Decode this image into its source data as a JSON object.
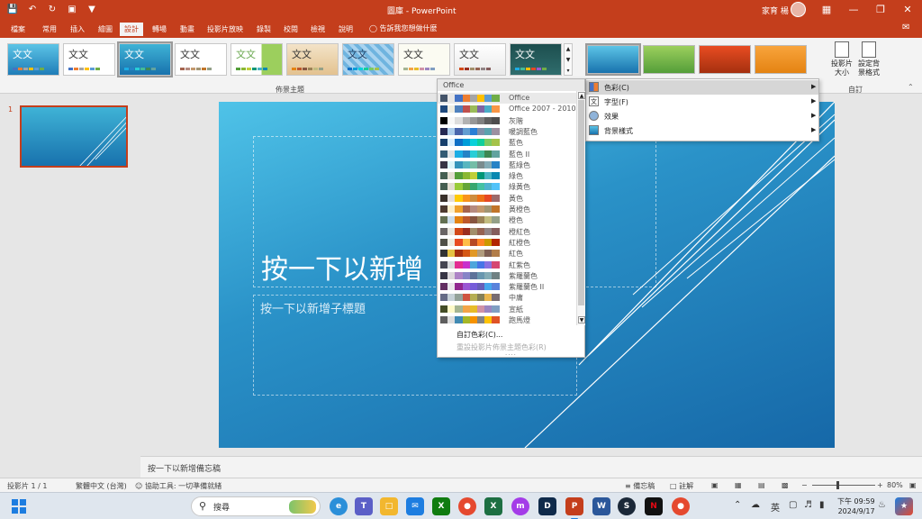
{
  "window": {
    "title": "圖庫 - PowerPoint",
    "user_name": "家育 楊"
  },
  "tabs": [
    {
      "label": "檔案",
      "active": false
    },
    {
      "label": "常用",
      "active": false
    },
    {
      "label": "插入",
      "active": false
    },
    {
      "label": "繪圖",
      "active": false
    },
    {
      "label": "設計",
      "active": true
    },
    {
      "label": "轉場",
      "active": false
    },
    {
      "label": "動畫",
      "active": false
    },
    {
      "label": "投影片放映",
      "active": false
    },
    {
      "label": "錄製",
      "active": false
    },
    {
      "label": "校閱",
      "active": false
    },
    {
      "label": "檢視",
      "active": false
    },
    {
      "label": "說明",
      "active": false
    }
  ],
  "tell_me": "告訴我您想做什麼",
  "ribbon": {
    "themes_group_label": "佈景主題",
    "theme_thumb_text": "文文",
    "customize_group_label": "自訂",
    "slide_size_label": "投影片大小",
    "format_bg_label": "設定背景格式"
  },
  "slide": {
    "number": "1",
    "title_placeholder": "按一下以新增",
    "subtitle_placeholder": "按一下以新增子標題"
  },
  "notes_placeholder": "按一下以新增備忘稿",
  "status": {
    "slide_count": "投影片 1 / 1",
    "language": "繁體中文 (台灣)",
    "accessibility": "協助工具: 一切準備就緒",
    "notes_btn": "備忘稿",
    "comments_btn": "註解",
    "zoom": "80%"
  },
  "taskbar": {
    "search_text": "搜尋",
    "ime": "英",
    "time": "下午 09:59",
    "date": "2024/9/17"
  },
  "color_menu": {
    "header": "Office",
    "schemes": [
      {
        "name": "Office",
        "colors": [
          "#44546a",
          "#e7e6e6",
          "#4472c4",
          "#ed7d31",
          "#a5a5a5",
          "#ffc000",
          "#5b9bd5",
          "#70ad47"
        ]
      },
      {
        "name": "Office 2007 - 2010",
        "colors": [
          "#1f497d",
          "#eeece1",
          "#4f81bd",
          "#c0504d",
          "#9bbb59",
          "#8064a2",
          "#4bacc6",
          "#f79646"
        ]
      },
      {
        "name": "灰階",
        "colors": [
          "#000000",
          "#f8f8f8",
          "#dddddd",
          "#b2b2b2",
          "#969696",
          "#808080",
          "#5f5f5f",
          "#4d4d4d"
        ]
      },
      {
        "name": "暖調藍色",
        "colors": [
          "#242852",
          "#acccea",
          "#4a66ac",
          "#629dd1",
          "#297fd5",
          "#7f8fa9",
          "#5aa2ae",
          "#9d90a0"
        ]
      },
      {
        "name": "藍色",
        "colors": [
          "#17406d",
          "#dbefff",
          "#0f6fc6",
          "#009dd9",
          "#0bd0d9",
          "#10cf9b",
          "#7cca62",
          "#a5c249"
        ]
      },
      {
        "name": "藍色 II",
        "colors": [
          "#335b74",
          "#dfe3e5",
          "#1cade4",
          "#2683c6",
          "#27ced7",
          "#42ba97",
          "#3e8853",
          "#62a39f"
        ]
      },
      {
        "name": "藍綠色",
        "colors": [
          "#373545",
          "#dbf5f9",
          "#3494ba",
          "#58b6c0",
          "#75bda7",
          "#7a8c8e",
          "#84acb6",
          "#2683c6"
        ]
      },
      {
        "name": "綠色",
        "colors": [
          "#455f51",
          "#e3ded1",
          "#549e39",
          "#8ab833",
          "#c0cf3a",
          "#029676",
          "#4ab5c4",
          "#0989b1"
        ]
      },
      {
        "name": "綠黃色",
        "colors": [
          "#455f51",
          "#e3ded1",
          "#99cb38",
          "#63a537",
          "#37a76f",
          "#44c1a3",
          "#4eb3cf",
          "#51c3f9"
        ]
      },
      {
        "name": "黃色",
        "colors": [
          "#39302a",
          "#e5dedb",
          "#ffca08",
          "#f8931d",
          "#ce8d3e",
          "#ec7016",
          "#e64823",
          "#9c6a6a"
        ]
      },
      {
        "name": "黃橙色",
        "colors": [
          "#4e3b30",
          "#fbeec9",
          "#f0a22e",
          "#a5644e",
          "#b58b80",
          "#c3986d",
          "#a19574",
          "#c17529"
        ]
      },
      {
        "name": "橙色",
        "colors": [
          "#637052",
          "#ccddea",
          "#e48312",
          "#bd582c",
          "#865640",
          "#9b8357",
          "#c2bc80",
          "#94a088"
        ]
      },
      {
        "name": "橙紅色",
        "colors": [
          "#696464",
          "#e9e5dc",
          "#d34817",
          "#9b2d1f",
          "#a28e6a",
          "#956251",
          "#918485",
          "#855d5d"
        ]
      },
      {
        "name": "紅橙色",
        "colors": [
          "#505046",
          "#eeece1",
          "#e84c22",
          "#ffbd47",
          "#b64926",
          "#ff8427",
          "#cc9900",
          "#b22600"
        ]
      },
      {
        "name": "紅色",
        "colors": [
          "#323232",
          "#e5c243",
          "#a5300f",
          "#d55816",
          "#e19825",
          "#b19c7d",
          "#7f5f52",
          "#b27d49"
        ]
      },
      {
        "name": "紅紫色",
        "colors": [
          "#454551",
          "#d8d9dc",
          "#e32d91",
          "#c830cc",
          "#4ea6dc",
          "#4775e7",
          "#8971e1",
          "#d54773"
        ]
      },
      {
        "name": "紫羅蘭色",
        "colors": [
          "#373545",
          "#dcd8dc",
          "#ad84c6",
          "#8784c7",
          "#5d739a",
          "#6997af",
          "#84acb6",
          "#6f8183"
        ]
      },
      {
        "name": "紫羅蘭色 II",
        "colors": [
          "#632e62",
          "#eae5eb",
          "#92278f",
          "#9b57d3",
          "#755dd9",
          "#665eb8",
          "#45a5ed",
          "#5982db"
        ]
      },
      {
        "name": "中庸",
        "colors": [
          "#646b86",
          "#c5d1d7",
          "#93a299",
          "#cf543f",
          "#b5ae53",
          "#848058",
          "#e8b54d",
          "#786c71"
        ]
      },
      {
        "name": "宣紙",
        "colors": [
          "#444d26",
          "#fefac9",
          "#a5b592",
          "#f3a447",
          "#e7bc29",
          "#d092a7",
          "#9c85c0",
          "#809ec2"
        ]
      },
      {
        "name": "跑馬燈",
        "colors": [
          "#5e5e5e",
          "#dddddd",
          "#418ab3",
          "#a6b727",
          "#f69200",
          "#838383",
          "#fec306",
          "#df5327"
        ]
      }
    ],
    "custom_label": "自訂色彩(C)...",
    "reset_label": "重設投影片佈景主題色彩(R)"
  },
  "variant_menu": [
    {
      "label": "色彩(C)",
      "icon": "color-palette-icon"
    },
    {
      "label": "字型(F)",
      "icon": "font-icon"
    },
    {
      "label": "效果",
      "icon": "effects-icon"
    },
    {
      "label": "背景樣式",
      "icon": "background-style-icon"
    }
  ]
}
